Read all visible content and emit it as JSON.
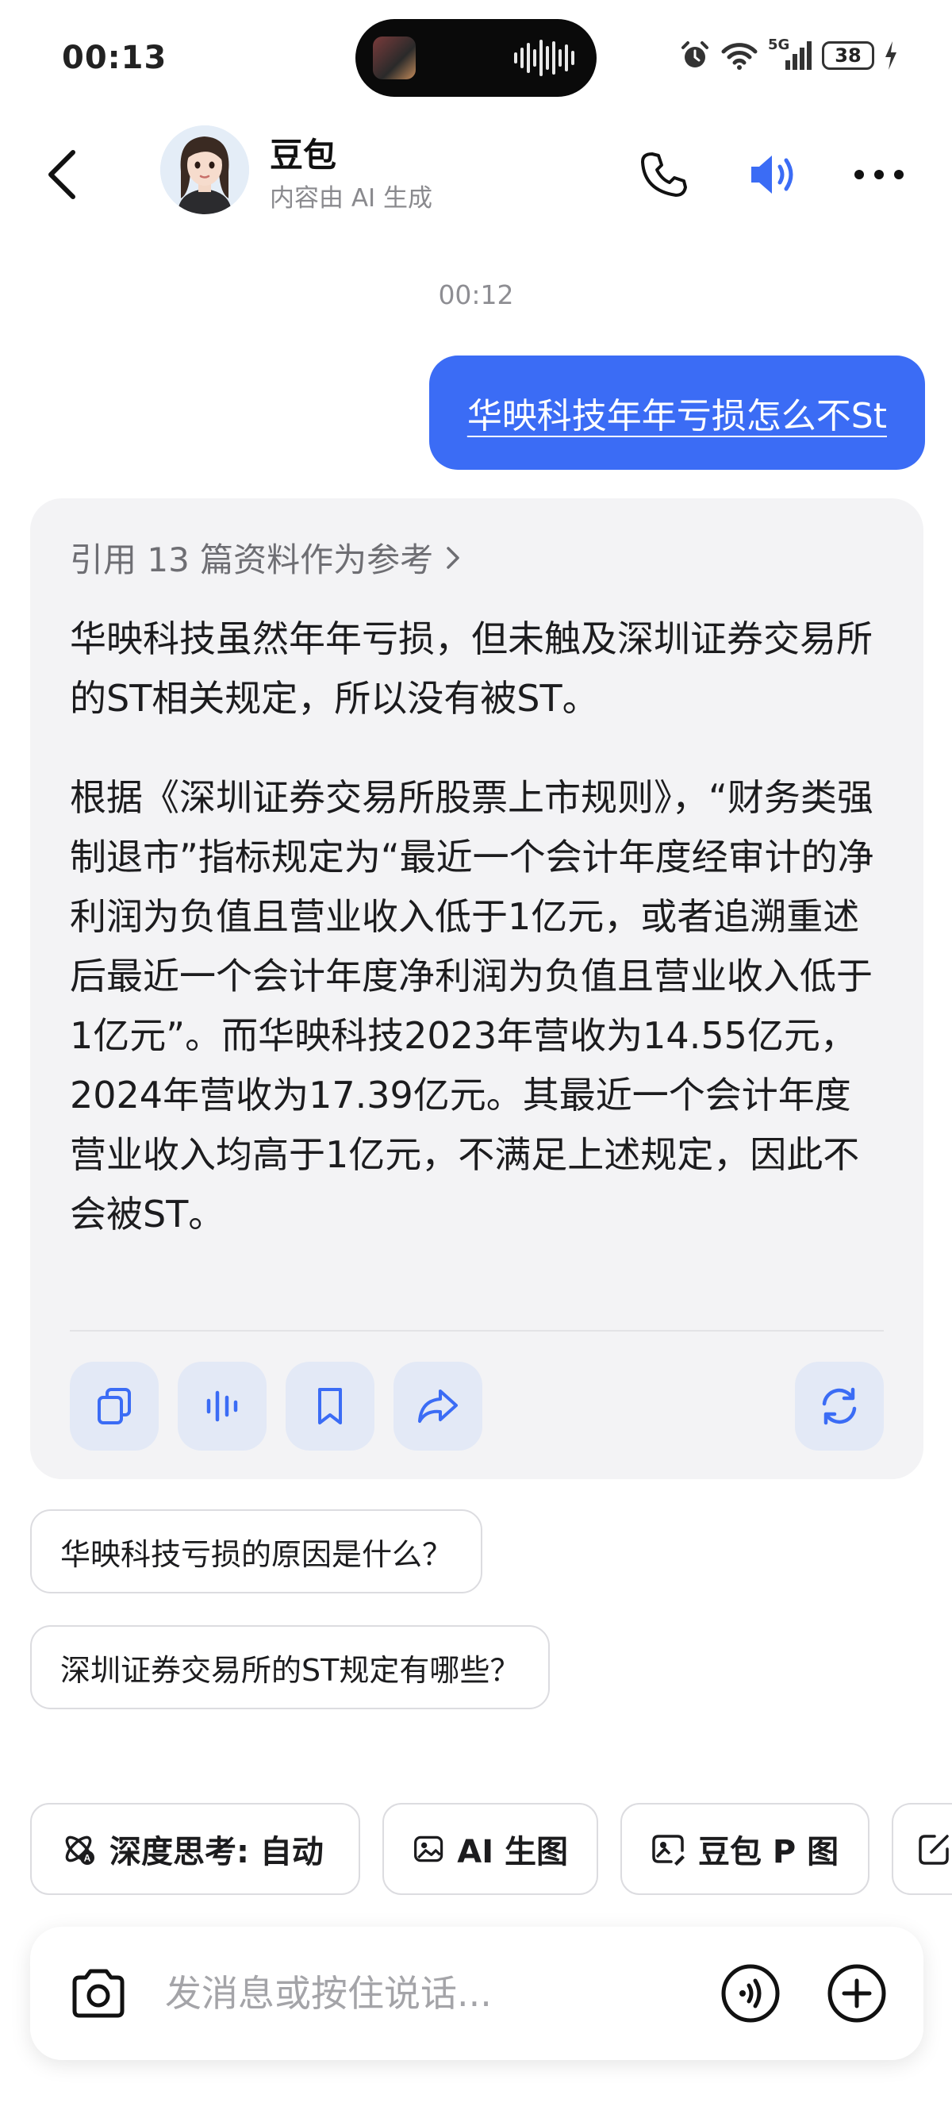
{
  "status_bar": {
    "time": "00:13",
    "network": "5G",
    "battery": "38"
  },
  "header": {
    "title": "豆包",
    "subtitle": "内容由 AI 生成"
  },
  "conversation": {
    "timestamp": "00:12",
    "user_message": "华映科技年年亏损怎么不St",
    "ai_reply": {
      "reference_text": "引用 13 篇资料作为参考",
      "paragraphs": [
        "华映科技虽然年年亏损，但未触及深圳证券交易所的ST相关规定，所以没有被ST。",
        "根据《深圳证券交易所股票上市规则》，“财务类强制退市”指标规定为“最近一个会计年度经审计的净利润为负值且营业收入低于1亿元，或者追溯重述后最近一个会计年度净利润为负值且营业收入低于1亿元”。而华映科技2023年营收为14.55亿元，2024年营收为17.39亿元。其最近一个会计年度营业收入均高于1亿元，不满足上述规定，因此不会被ST。"
      ],
      "actions": [
        "copy-icon",
        "voice-play-icon",
        "bookmark-icon",
        "share-icon",
        "regenerate-icon"
      ]
    },
    "suggestions": [
      "华映科技亏损的原因是什么？",
      "深圳证券交易所的ST规定有哪些？"
    ]
  },
  "tools": [
    {
      "label": "深度思考: 自动",
      "icon": "deep-think-icon"
    },
    {
      "label": "AI 生图",
      "icon": "image-gen-icon"
    },
    {
      "label": "豆包 P 图",
      "icon": "photo-edit-icon"
    },
    {
      "label": "",
      "icon": "write-icon"
    }
  ],
  "input": {
    "placeholder": "发消息或按住说话..."
  },
  "colors": {
    "accent": "#3b6cf5",
    "card_bg": "#f3f3f5",
    "action_bg": "#e3e9f6"
  }
}
